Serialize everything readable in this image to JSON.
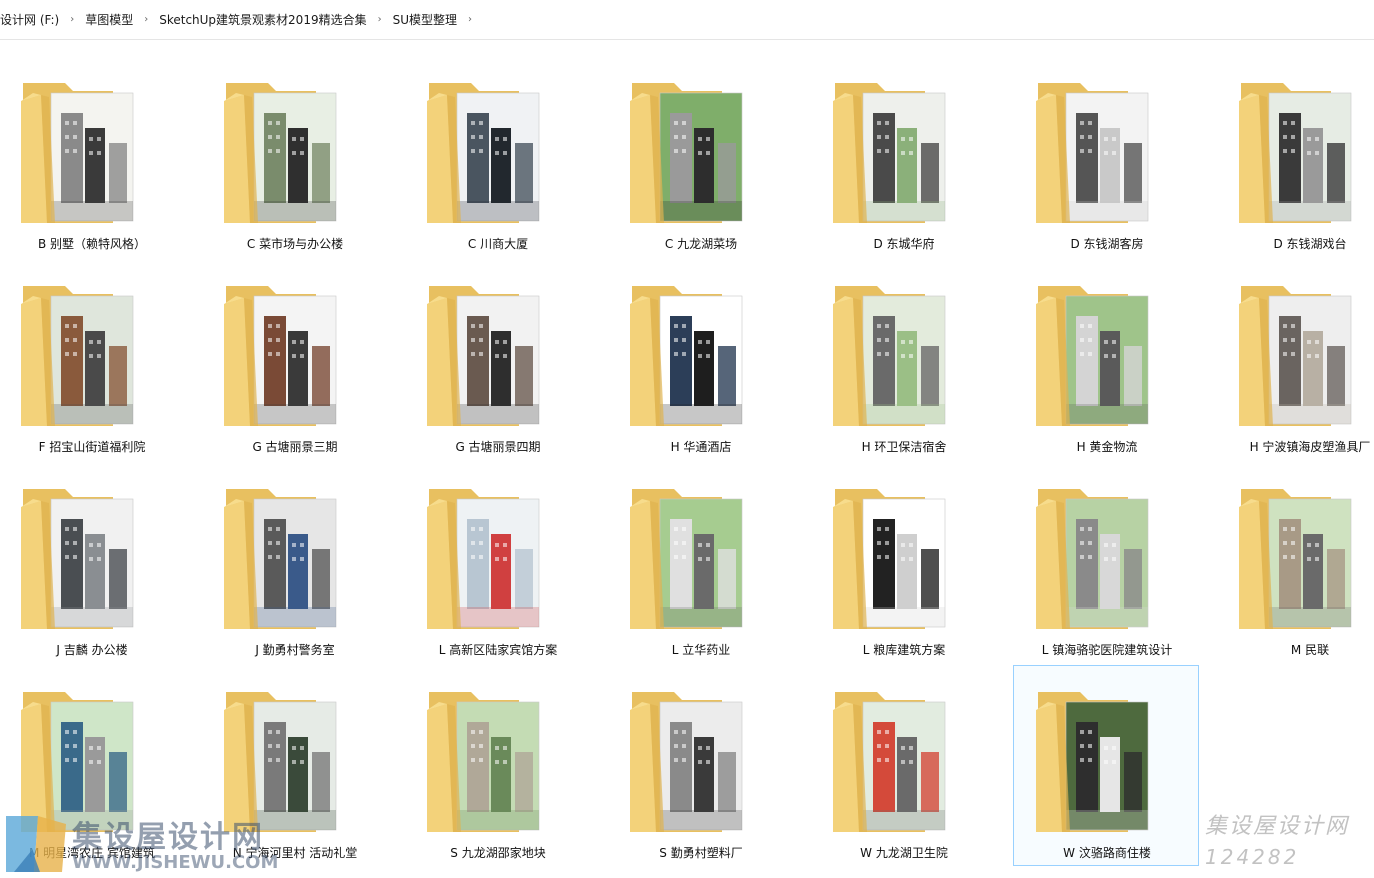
{
  "breadcrumb": [
    "设计网 (F:)",
    "草图模型",
    "SketchUp建筑景观素材2019精选合集",
    "SU模型整理"
  ],
  "folders": [
    {
      "label": "B 别墅（赖特风格）"
    },
    {
      "label": "C 菜市场与办公楼"
    },
    {
      "label": "C 川商大厦"
    },
    {
      "label": "C 九龙湖菜场"
    },
    {
      "label": "D 东城华府"
    },
    {
      "label": "D 东钱湖客房"
    },
    {
      "label": "D 东钱湖戏台"
    },
    {
      "label": "F 招宝山街道福利院"
    },
    {
      "label": "G 古塘丽景三期"
    },
    {
      "label": "G 古塘丽景四期"
    },
    {
      "label": "H 华通酒店"
    },
    {
      "label": "H 环卫保洁宿舍"
    },
    {
      "label": "H 黄金物流"
    },
    {
      "label": "H 宁波镇海皮塑渔具厂"
    },
    {
      "label": "J 吉麟 办公楼"
    },
    {
      "label": "J 勤勇村警务室"
    },
    {
      "label": "L 高新区陆家宾馆方案"
    },
    {
      "label": "L 立华药业"
    },
    {
      "label": "L 粮库建筑方案"
    },
    {
      "label": "L 镇海骆驼医院建筑设计"
    },
    {
      "label": "M 民联"
    },
    {
      "label": "M 明星湾农庄 宾馆建筑"
    },
    {
      "label": "N 宁海河里村 活动礼堂"
    },
    {
      "label": "S 九龙湖邵家地块"
    },
    {
      "label": "S 勤勇村塑料厂"
    },
    {
      "label": "W 九龙湖卫生院"
    },
    {
      "label": "W 汶骆路商住楼"
    }
  ],
  "watermark": {
    "cn": "集设屋设计网",
    "url": "WWW.JISHEWU.COM",
    "right_cn": "集设屋设计网",
    "right_id": "124282"
  }
}
